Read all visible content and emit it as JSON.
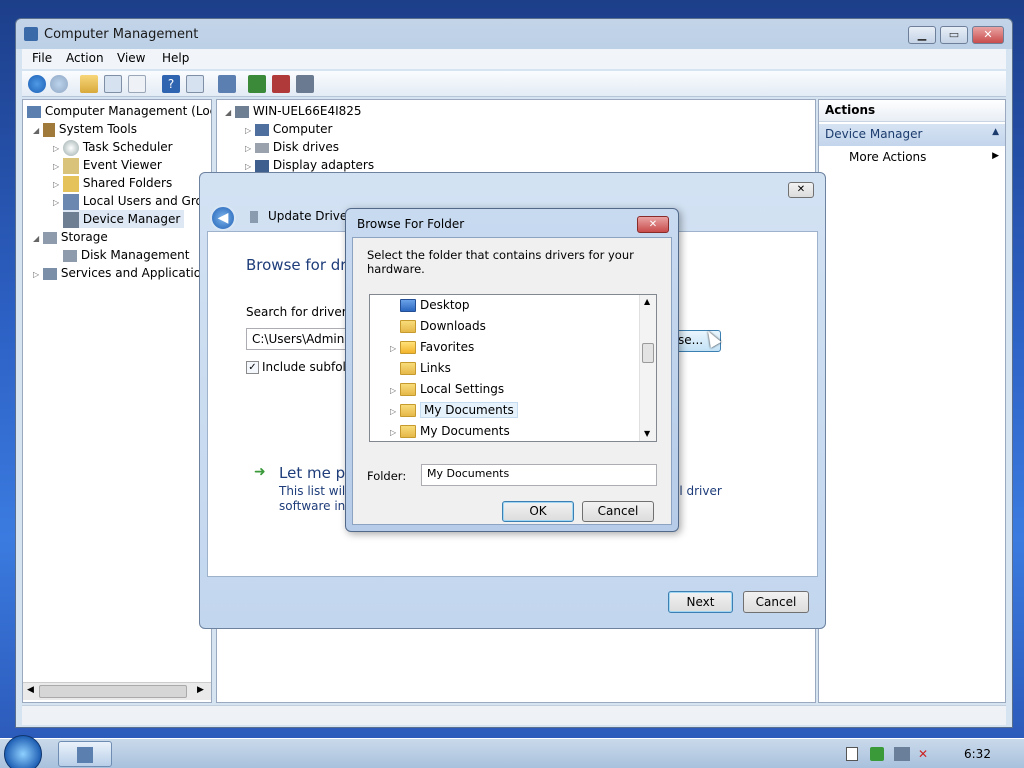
{
  "window": {
    "title": "Computer Management",
    "menus": [
      "File",
      "Action",
      "View",
      "Help"
    ]
  },
  "tree": {
    "root": "Computer Management (Local",
    "system_tools": "System Tools",
    "task_scheduler": "Task Scheduler",
    "event_viewer": "Event Viewer",
    "shared_folders": "Shared Folders",
    "local_users": "Local Users and Group",
    "device_manager": "Device Manager",
    "storage": "Storage",
    "disk_management": "Disk Management",
    "services": "Services and Applications"
  },
  "devices": {
    "host": "WIN-UEL66E4I825",
    "items": [
      "Computer",
      "Disk drives",
      "Display adapters"
    ]
  },
  "actions": {
    "header": "Actions",
    "section": "Device Manager",
    "more": "More Actions"
  },
  "update_dialog": {
    "title": "Update Driver S",
    "heading": "Browse for driv",
    "search_label": "Search for driver so",
    "path_value": "C:\\Users\\Administ",
    "include_sub": "Include subfolde",
    "browse_btn": "se...",
    "let_me_pick": "Let me pic",
    "desc_line1": "This list will s",
    "desc_line1_tail": "ll driver",
    "desc_line2": "software in th",
    "next": "Next",
    "cancel": "Cancel"
  },
  "browse_dialog": {
    "title": "Browse For Folder",
    "instruction": "Select the folder that contains drivers for your hardware.",
    "folders": [
      "Desktop",
      "Downloads",
      "Favorites",
      "Links",
      "Local Settings",
      "My Documents",
      "My Documents"
    ],
    "folder_label": "Folder:",
    "folder_value": "My Documents",
    "ok": "OK",
    "cancel": "Cancel"
  },
  "taskbar": {
    "clock": "6:32"
  }
}
